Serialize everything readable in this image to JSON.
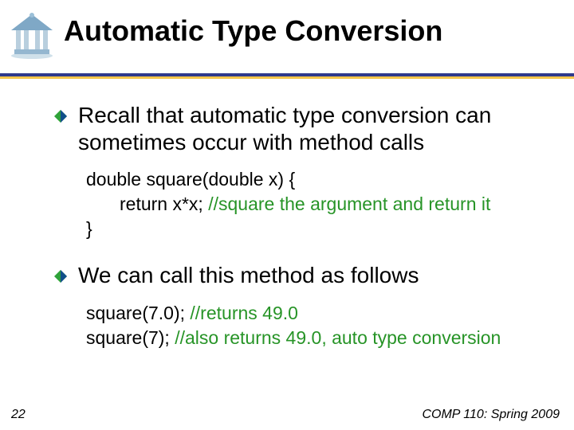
{
  "title": "Automatic Type Conversion",
  "bullets": {
    "b1": "Recall that automatic type conversion can sometimes occur with method calls",
    "b2": "We can call this method as follows"
  },
  "code1": {
    "l1a": "double square(double x)  {",
    "l2a": "return x*x; ",
    "l2b": "//square the argument and return it",
    "l3a": "}"
  },
  "code2": {
    "l1a": "square(7.0); ",
    "l1b": "//returns 49.0",
    "l2a": "square(7); ",
    "l2b": "//also returns 49.0, auto type conversion"
  },
  "footer": {
    "page": "22",
    "course": "COMP 110: Spring 2009"
  },
  "icons": {
    "logo": "unc-old-well-icon",
    "bullet": "diamond-bullet-icon"
  }
}
